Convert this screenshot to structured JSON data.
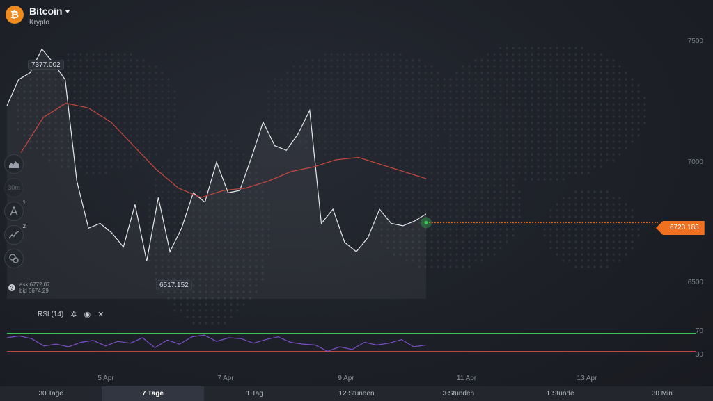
{
  "asset": {
    "name": "Bitcoin",
    "category": "Krypto",
    "icon": "bitcoin-icon"
  },
  "tools": [
    {
      "name": "area-chart-icon",
      "badge": ""
    },
    {
      "name": "timeframe-icon",
      "label": "30m",
      "badge": ""
    },
    {
      "name": "draw-tool-icon",
      "badge": "1"
    },
    {
      "name": "indicator-icon",
      "badge": "2"
    },
    {
      "name": "settings-coins-icon",
      "badge": ""
    }
  ],
  "ask_bid": {
    "ask": "ask 6772.07",
    "bid": "bid 6674.29"
  },
  "price": {
    "current": "6723.183",
    "high_label": "7377.002",
    "low_label": "6517.152"
  },
  "colors": {
    "accent": "#f0701f",
    "price_line": "#e6e8ec",
    "ma_line": "#c0473f",
    "rsi_line": "#7b4fc9",
    "rsi_upper": "#3cc45a",
    "rsi_lower": "#c0473f"
  },
  "rsi": {
    "label": "RSI (14)",
    "upper": "70",
    "lower": "30"
  },
  "chart_data": {
    "type": "line",
    "y_axis": {
      "ticks": [
        "7500",
        "7000",
        "6500"
      ],
      "range": [
        6400,
        7550
      ]
    },
    "x_axis": {
      "ticks": [
        "5 Apr",
        "7 Apr",
        "9 Apr",
        "11 Apr",
        "13 Apr"
      ]
    },
    "series": [
      {
        "values": [
          7220,
          7330,
          7360,
          7460,
          7400,
          7330,
          6900,
          6700,
          6720,
          6680,
          6620,
          6800,
          6560,
          6830,
          6600,
          6700,
          6850,
          6810,
          6980,
          6850,
          6860,
          7000,
          7150,
          7050,
          7030,
          7100,
          7200,
          6720,
          6780,
          6640,
          6600,
          6660,
          6780,
          6720,
          6710,
          6730,
          6760
        ]
      },
      {
        "values": [
          7020,
          7170,
          7230,
          7210,
          7150,
          7050,
          6950,
          6870,
          6830,
          6860,
          6870,
          6900,
          6940,
          6960,
          6990,
          7000,
          6970,
          6940,
          6910
        ]
      }
    ]
  },
  "rsi_data": {
    "values": [
      60,
      64,
      58,
      42,
      46,
      40,
      50,
      54,
      42,
      52,
      48,
      60,
      38,
      55,
      46,
      62,
      66,
      52,
      60,
      58,
      48,
      56,
      62,
      50,
      46,
      44,
      30,
      40,
      34,
      50,
      44,
      48,
      56,
      40,
      44
    ]
  },
  "timeframes": [
    {
      "label": "30 Tage",
      "active": false
    },
    {
      "label": "7 Tage",
      "active": true
    },
    {
      "label": "1 Tag",
      "active": false
    },
    {
      "label": "12 Stunden",
      "active": false
    },
    {
      "label": "3 Stunden",
      "active": false
    },
    {
      "label": "1 Stunde",
      "active": false
    },
    {
      "label": "30 Min",
      "active": false
    }
  ]
}
